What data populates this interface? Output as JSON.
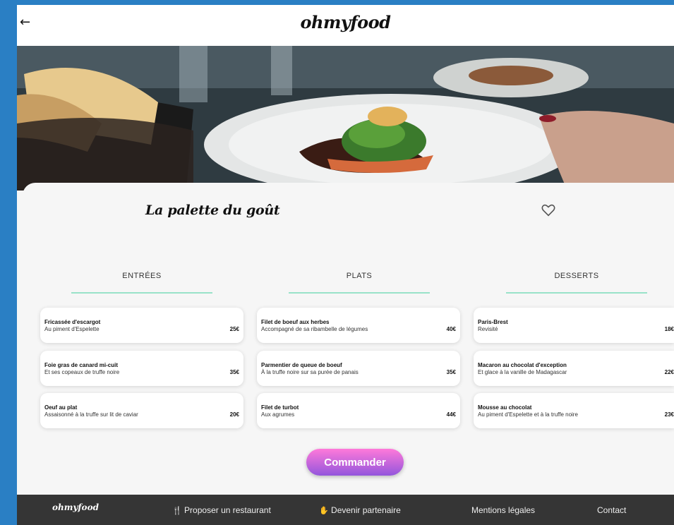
{
  "header": {
    "back_icon": "arrow-left-icon",
    "logo": "ohmyfood"
  },
  "restaurant": {
    "name": "La palette du goût",
    "favorite_icon": "heart-outline-icon"
  },
  "menu": {
    "columns": [
      {
        "title": "ENTRÉES",
        "dishes": [
          {
            "name": "Fricassée d'escargot",
            "desc": "Au piment d'Espelette",
            "price": "25€"
          },
          {
            "name": "Foie gras de canard mi-cuit",
            "desc": "Et ses copeaux de truffe noire",
            "price": "35€"
          },
          {
            "name": "Oeuf au plat",
            "desc": "Assaisonné à la truffe sur lit de caviar",
            "price": "20€"
          }
        ]
      },
      {
        "title": "PLATS",
        "dishes": [
          {
            "name": "Filet de boeuf aux herbes",
            "desc": "Accompagné de sa ribambelle de légumes",
            "price": "40€"
          },
          {
            "name": "Parmentier de queue de boeuf",
            "desc": "À la truffe noire sur sa purée de panais",
            "price": "35€"
          },
          {
            "name": "Filet de turbot",
            "desc": "Aux agrumes",
            "price": "44€"
          }
        ]
      },
      {
        "title": "DESSERTS",
        "dishes": [
          {
            "name": "Paris-Brest",
            "desc": "Revisité",
            "price": "18€"
          },
          {
            "name": "Macaron au chocolat d'exception",
            "desc": "Et glace à la vanille de Madagascar",
            "price": "22€"
          },
          {
            "name": "Mousse au chocolat",
            "desc": "Au piment d'Espelette et à la truffe noire",
            "price": "23€"
          }
        ]
      }
    ]
  },
  "order_button": "Commander",
  "footer": {
    "logo": "ohmyfood",
    "propose": "Proposer un restaurant",
    "partner": "Devenir partenaire",
    "legal": "Mentions légales",
    "contact": "Contact",
    "propose_icon": "fork-knife-icon",
    "partner_icon": "handshake-icon"
  },
  "colors": {
    "accent_line": "#99e2c9",
    "button_top": "#ff79da",
    "button_bottom": "#9356dc",
    "footer_bg": "#353535",
    "frame_bg": "#2a7fc4"
  }
}
